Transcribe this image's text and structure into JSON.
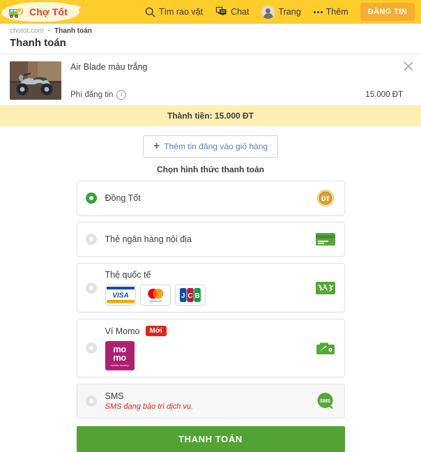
{
  "header": {
    "logo_text": "Chợ Tốt",
    "logo_icon": "shop-cart-icon",
    "nav": [
      {
        "label": "Tìm rao vặt",
        "icon": "search-icon",
        "name": "nav-search"
      },
      {
        "label": "Chat",
        "icon": "chat-icon",
        "name": "nav-chat"
      },
      {
        "label": "Trang",
        "icon": "avatar-icon",
        "name": "nav-account"
      },
      {
        "label": "Thêm",
        "icon": "more-dots-icon",
        "name": "nav-more"
      }
    ],
    "post_button": "ĐĂNG TIN"
  },
  "breadcrumb": {
    "site": "chotot.com",
    "separator": "•",
    "current": "Thanh toán"
  },
  "page_title": "Thanh toán",
  "item": {
    "title": "Air Blade màu trắng",
    "thumbnail": "motorbike-photo",
    "fee_label": "Phí đăng tin",
    "fee_info_icon": "info-icon",
    "fee_amount": "15.000 ĐT",
    "remove_icon": "close-icon"
  },
  "total": {
    "text": "Thành tiền: 15.000 ĐT"
  },
  "add_post": {
    "plus": "+",
    "label": "Thêm tin đăng vào giỏ hàng"
  },
  "section": {
    "title": "Chọn hình thức thanh toán"
  },
  "payment_options": [
    {
      "name": "payment-option-dong-tot",
      "label": "Đồng Tốt",
      "selected": true,
      "disabled": false,
      "icon": "dong-tot-coin-icon",
      "badge": "",
      "sub": "",
      "logos": []
    },
    {
      "name": "payment-option-domestic-card",
      "label": "Thẻ ngân hàng nội địa",
      "selected": false,
      "disabled": false,
      "icon": "credit-card-icon",
      "badge": "",
      "sub": "",
      "logos": []
    },
    {
      "name": "payment-option-international-card",
      "label": "Thẻ quốc tế",
      "selected": false,
      "disabled": false,
      "icon": "world-card-icon",
      "badge": "",
      "sub": "",
      "logos": [
        "visa-logo",
        "mastercard-logo",
        "jcb-logo"
      ]
    },
    {
      "name": "payment-option-momo",
      "label": "Ví Momo",
      "selected": false,
      "disabled": false,
      "icon": "wallet-icon",
      "badge": "Mới",
      "sub": "",
      "logos": [
        "momo-logo"
      ]
    },
    {
      "name": "payment-option-sms",
      "label": "SMS",
      "selected": false,
      "disabled": true,
      "icon": "sms-bubble-icon",
      "badge": "",
      "sub": "SMS đang bảo trì dịch vụ.",
      "logos": []
    }
  ],
  "pay_button": {
    "label": "THANH TOÁN"
  },
  "colors": {
    "header_yellow": "#ffcd2b",
    "post_button_orange": "#f5ad33",
    "brand_red": "#e03c31",
    "total_bar_yellow": "#fdeeb4",
    "accent_green": "#52a334",
    "radio_green": "#36a33b",
    "alert_red": "#e2231a",
    "momo_pink": "#ae2070"
  }
}
